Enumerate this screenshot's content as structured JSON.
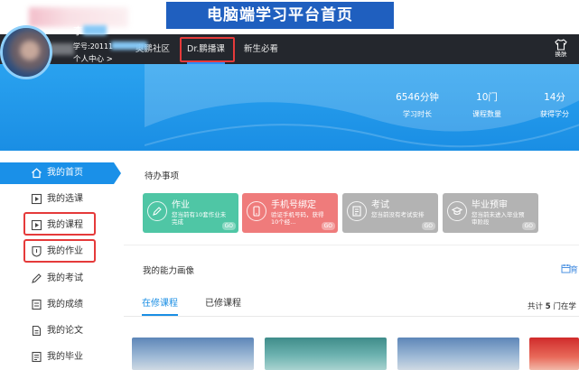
{
  "banner": {
    "title": "电脑端学习平台首页"
  },
  "navbar": {
    "items": [
      {
        "label": "奥鹏社区"
      },
      {
        "label": "Dr.鹏播课"
      },
      {
        "label": "新生必看"
      }
    ],
    "skin_label": "换肤",
    "active_index": 1
  },
  "user": {
    "name": "李",
    "id_label": "学号:20111",
    "center_link": "个人中心 >"
  },
  "stats": [
    {
      "value": "6546分钟",
      "label": "学习时长"
    },
    {
      "value": "10门",
      "label": "课程数量"
    },
    {
      "value": "14分",
      "label": "获得学分"
    }
  ],
  "sidebar": {
    "items": [
      {
        "label": "我的首页",
        "icon": "home-icon"
      },
      {
        "label": "我的选课",
        "icon": "course-select-icon"
      },
      {
        "label": "我的课程",
        "icon": "course-icon"
      },
      {
        "label": "我的作业",
        "icon": "homework-icon"
      },
      {
        "label": "我的考试",
        "icon": "exam-icon"
      },
      {
        "label": "我的成绩",
        "icon": "score-icon"
      },
      {
        "label": "我的论文",
        "icon": "paper-icon"
      },
      {
        "label": "我的毕业",
        "icon": "graduation-icon"
      }
    ],
    "active_index": 0
  },
  "todo": {
    "title": "待办事项",
    "cards": [
      {
        "title": "作业",
        "desc": "您当前有10套作业未完成",
        "badge": "GO",
        "color": "#4fc6a5"
      },
      {
        "title": "手机号绑定",
        "desc": "验证手机号码，获得10个经...",
        "badge": "GO",
        "color": "#ef7b7b"
      },
      {
        "title": "考试",
        "desc": "您当前没有考试安排",
        "badge": "GO",
        "color": "#b3b3b3"
      },
      {
        "title": "毕业预审",
        "desc": "您当前未进入毕业预审阶段",
        "badge": "GO",
        "color": "#b3b3b3"
      }
    ]
  },
  "ability": {
    "title": "我的能力画像",
    "more": "育"
  },
  "tabs": [
    {
      "label": "在修课程"
    },
    {
      "label": "已修课程"
    }
  ],
  "course_count": {
    "prefix": "共计",
    "count": "5",
    "suffix": "门在学"
  },
  "colors": {
    "accent": "#1a8ee4",
    "navbar": "#24272d",
    "highlight_red": "#e53a3a"
  }
}
